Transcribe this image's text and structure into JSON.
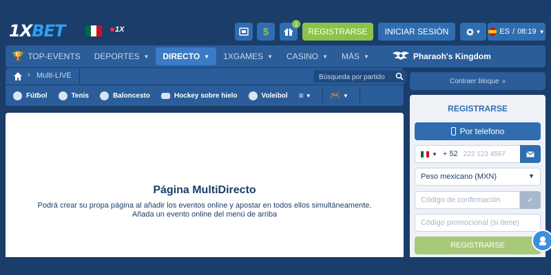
{
  "header": {
    "logo_main": "1X",
    "logo_accent": "BET",
    "mini_logo": "1X",
    "register_label": "REGISTRARSE",
    "login_label": "INICIAR SESIÓN",
    "gift_badge": "1",
    "lang": "ES",
    "time": "08:19",
    "dollar_glyph": "$"
  },
  "nav": {
    "items": [
      {
        "label": "TOP-EVENTS"
      },
      {
        "label": "DEPORTES"
      },
      {
        "label": "DIRECTO"
      },
      {
        "label": "1XGAMES"
      },
      {
        "label": "CASINO"
      },
      {
        "label": "MÁS"
      }
    ],
    "promo_label": "Pharaoh's Kingdom"
  },
  "breadcrumb": {
    "current": "Multi-LIVE",
    "search_placeholder": "Búsqueda por partido"
  },
  "sports": [
    {
      "label": "Fútbol"
    },
    {
      "label": "Tenis"
    },
    {
      "label": "Baloncesto"
    },
    {
      "label": "Hockey sobre hielo"
    },
    {
      "label": "Voleibol"
    }
  ],
  "main": {
    "title": "Página MultiDirecto",
    "text1": "Podrá crear su propa página al añadir los eventos online y apostar en todos ellos simultáneamente.",
    "text2": "Añada un evento online del menú de arriba"
  },
  "sidebar": {
    "collapse_label": "Contraer bloque",
    "reg_title": "REGISTRARSE",
    "by_phone_label": "Por telefono",
    "phone_code": "+ 52",
    "phone_placeholder": "222 123 4567",
    "currency": "Peso mexicano (MXN)",
    "code_placeholder": "Código de confirmación",
    "promo_placeholder": "Código promocional (si tiene)",
    "submit_label": "REGISTRARSE"
  },
  "colors": {
    "background": "#1b3d6a",
    "nav": "#2a5d99",
    "accent_blue": "#2f6db0",
    "accent_green": "#8bc34a"
  }
}
